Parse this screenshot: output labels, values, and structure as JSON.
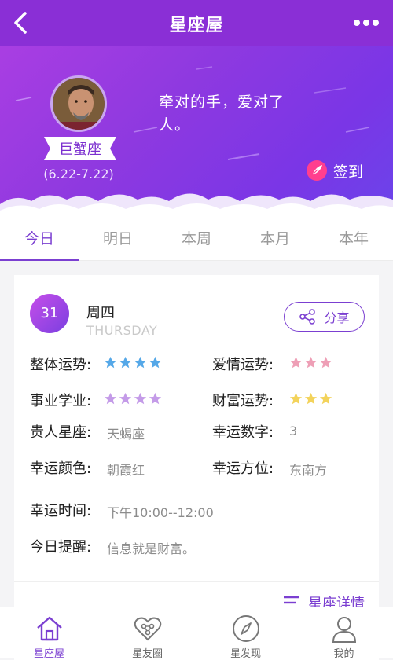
{
  "header": {
    "title": "星座屋",
    "bg_color": "#8a2fd6",
    "back_icon": "back-arrow-icon",
    "more_icon": "more-dots-icon"
  },
  "profile": {
    "sign_name": "巨蟹座",
    "date_range": "(6.22-7.22)",
    "quote": "牵对的手，爱对了人。",
    "checkin_label": "签到"
  },
  "tabs": [
    {
      "label": "今日",
      "active": true
    },
    {
      "label": "明日",
      "active": false
    },
    {
      "label": "本周",
      "active": false
    },
    {
      "label": "本月",
      "active": false
    },
    {
      "label": "本年",
      "active": false
    }
  ],
  "card": {
    "date": "31",
    "weekday": "周四",
    "weekday_en": "THURSDAY",
    "share_label": "分享",
    "fortunes": [
      {
        "label": "整体运势:",
        "stars": 4,
        "color": "#55a8e8"
      },
      {
        "label": "爱情运势:",
        "stars": 3,
        "color": "#ee9fb6"
      },
      {
        "label": "事业学业:",
        "stars": 4,
        "color": "#c49be8"
      },
      {
        "label": "财富运势:",
        "stars": 3,
        "color": "#f3d35b"
      }
    ],
    "info": [
      {
        "label": "贵人星座:",
        "value": "天蝎座"
      },
      {
        "label": "幸运数字:",
        "value": "3"
      },
      {
        "label": "幸运颜色:",
        "value": "朝霞红"
      },
      {
        "label": "幸运方位:",
        "value": "东南方"
      },
      {
        "label": "幸运时间:",
        "value": "下午10:00--12:00"
      },
      {
        "label": "今日提醒:",
        "value": "信息就是财富。"
      }
    ],
    "detail_label": "星座详情"
  },
  "bottom_nav": [
    {
      "label": "星座屋",
      "icon": "house-icon",
      "active": true
    },
    {
      "label": "星友圈",
      "icon": "heart-network-icon",
      "active": false
    },
    {
      "label": "星发现",
      "icon": "compass-icon",
      "active": false
    },
    {
      "label": "我的",
      "icon": "user-icon",
      "active": false
    }
  ],
  "accent_color": "#7b3fd1"
}
